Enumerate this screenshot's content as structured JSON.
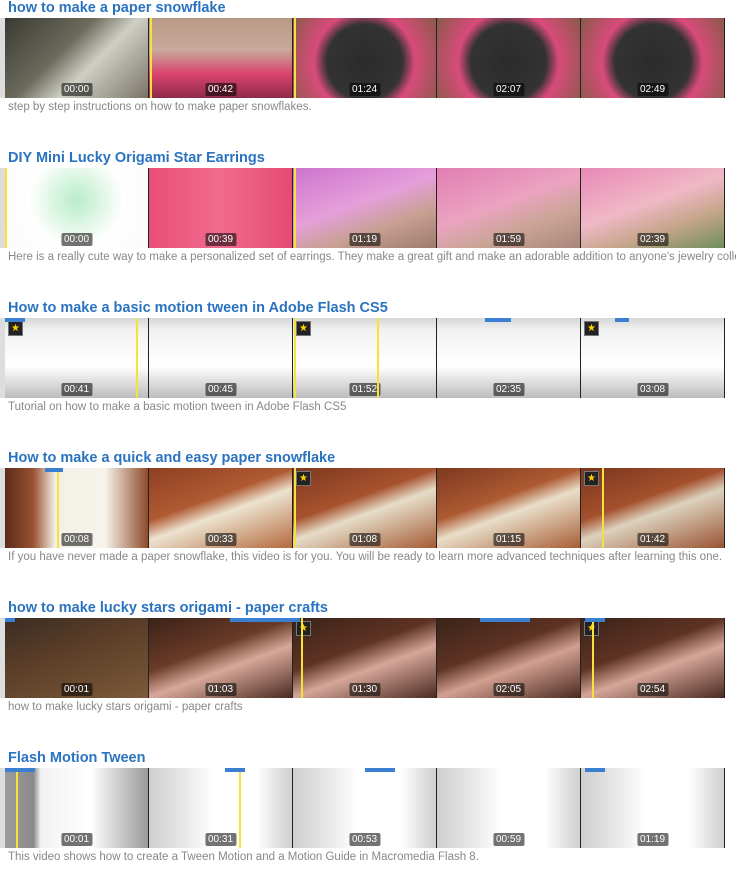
{
  "videos": [
    {
      "title": "how to make a paper snowflake",
      "description": "step by step instructions on how to make paper snowflakes.",
      "frames": [
        {
          "time": "00:00",
          "bg": "linear-gradient(135deg,#3a3a34 0%,#6b6a5c 40%,#cfcfc6 60%,#7a7468 100%)",
          "star": false
        },
        {
          "time": "00:42",
          "bg": "linear-gradient(180deg,#b79a86 0%,#c8a99a 40%,#d9446e 70%,#8e2a4a 100%)",
          "star": false
        },
        {
          "time": "01:24",
          "bg": "radial-gradient(circle at 50% 55%,#2b2b2b 0%,#333 45%,#d84b7a 60%,#8a5a4a 100%)",
          "star": false
        },
        {
          "time": "02:07",
          "bg": "radial-gradient(circle at 50% 55%,#2b2b2b 0%,#333 45%,#d84b7a 60%,#8a5a4a 100%)",
          "star": false
        },
        {
          "time": "02:49",
          "bg": "radial-gradient(circle at 50% 55%,#2b2b2b 0%,#333 45%,#d84b7a 60%,#8a5a4a 100%)",
          "star": false
        }
      ]
    },
    {
      "title": "DIY Mini Lucky Origami Star Earrings",
      "description": "Here is a really cute way to make a personalized set of earrings. They make a great gift and make an adorable addition to anyone's jewelry collection.",
      "frames": [
        {
          "time": "00:00",
          "bg": "radial-gradient(circle at 50% 40%,#b9ecc8 0%,#ffffff 55%,#fafafa 100%)",
          "star": false
        },
        {
          "time": "00:39",
          "bg": "linear-gradient(90deg,#ea4d79 0%,#f06b8e 50%,#e64a73 100%)",
          "star": false
        },
        {
          "time": "01:19",
          "bg": "linear-gradient(160deg,#cc74cf 0%,#e59fd9 45%,#c7a092 70%,#9d7b6c 100%)",
          "star": false
        },
        {
          "time": "01:59",
          "bg": "linear-gradient(160deg,#e27db2 0%,#eba3c0 45%,#caa596 70%,#a8857a 100%)",
          "star": false
        },
        {
          "time": "02:39",
          "bg": "linear-gradient(160deg,#e889b6 0%,#f0b8c6 45%,#c5a68a 70%,#6f8d5c 100%)",
          "star": false
        }
      ]
    },
    {
      "title": "How to make a basic motion tween in Adobe Flash CS5",
      "description": "Tutorial on how to make a basic motion tween in Adobe Flash CS5",
      "frames": [
        {
          "time": "00:41",
          "bg": "linear-gradient(180deg,#d6d6d6 0%,#f2f2f2 15%,#ffffff 60%,#bdbdbd 100%)",
          "star": true
        },
        {
          "time": "00:45",
          "bg": "linear-gradient(180deg,#d6d6d6 0%,#f2f2f2 15%,#ffffff 60%,#bdbdbd 100%)",
          "star": false
        },
        {
          "time": "01:52",
          "bg": "linear-gradient(180deg,#d6d6d6 0%,#f2f2f2 15%,#ffffff 60%,#bdbdbd 100%)",
          "star": true
        },
        {
          "time": "02:35",
          "bg": "linear-gradient(180deg,#d6d6d6 0%,#f2f2f2 15%,#ffffff 60%,#bdbdbd 100%)",
          "star": false
        },
        {
          "time": "03:08",
          "bg": "linear-gradient(180deg,#d6d6d6 0%,#f2f2f2 15%,#ffffff 60%,#bdbdbd 100%)",
          "star": true
        }
      ]
    },
    {
      "title": "How to make a quick and easy paper snowflake",
      "description": "If you have never made a paper snowflake, this video is for you. You will be ready to learn more advanced techniques after learning this one.",
      "frames": [
        {
          "time": "00:08",
          "bg": "linear-gradient(90deg,#5b2b1a 0%,#9a5332 20%,#f3f0e8 35%,#f6f3ea 70%,#8e4b2b 100%)",
          "star": false
        },
        {
          "time": "00:33",
          "bg": "linear-gradient(160deg,#8e3f22 0%,#b05a33 40%,#ece3d0 55%,#b4693c 100%)",
          "star": false
        },
        {
          "time": "01:08",
          "bg": "linear-gradient(160deg,#7e3820 0%,#a7522e 40%,#e6ddc9 55%,#a45a33 100%)",
          "star": true
        },
        {
          "time": "01:15",
          "bg": "linear-gradient(160deg,#7e3820 0%,#ad5a32 40%,#e9deca 55%,#a85e35 100%)",
          "star": false
        },
        {
          "time": "01:42",
          "bg": "linear-gradient(160deg,#7a3620 0%,#a4502c 40%,#dcd2be 55%,#9a5332 100%)",
          "star": true
        }
      ]
    },
    {
      "title": "how to make lucky stars origami - paper crafts",
      "description": "how to make lucky stars origami - paper crafts",
      "frames": [
        {
          "time": "00:01",
          "bg": "linear-gradient(160deg,#3a2d22 0%,#5a3d28 40%,#7a5a3a 100%)",
          "star": false
        },
        {
          "time": "01:03",
          "bg": "linear-gradient(160deg,#3a2318 0%,#6a3a28 40%,#d8a89a 60%,#4a2a20 100%)",
          "star": false
        },
        {
          "time": "01:30",
          "bg": "linear-gradient(160deg,#3a2318 0%,#5e3324 40%,#d6a699 60%,#4a2a20 100%)",
          "star": true
        },
        {
          "time": "02:05",
          "bg": "linear-gradient(160deg,#3a2318 0%,#5e3324 40%,#d29f90 60%,#4a2a20 100%)",
          "star": false
        },
        {
          "time": "02:54",
          "bg": "linear-gradient(160deg,#3a2318 0%,#5e3324 40%,#d6a699 60%,#4a2a20 100%)",
          "star": true
        }
      ]
    },
    {
      "title": "Flash Motion Tween",
      "description": "This video shows how to create a Tween Motion and a Motion Guide in Macromedia Flash 8.",
      "frames": [
        {
          "time": "00:01",
          "bg": "linear-gradient(90deg,#9c9c9c 0%,#8a8a8a 20%,#f2f2f2 25%,#ffffff 60%,#9a9a9a 100%)",
          "star": false
        },
        {
          "time": "00:31",
          "bg": "linear-gradient(90deg,#cfcfcf 0%,#e8e8e8 25%,#ffffff 45%,#ffffff 75%,#cfcfcf 100%)",
          "star": false
        },
        {
          "time": "00:53",
          "bg": "linear-gradient(90deg,#cfcfcf 0%,#e8e8e8 25%,#ffffff 45%,#ffffff 75%,#cfcfcf 100%)",
          "star": false
        },
        {
          "time": "00:59",
          "bg": "linear-gradient(90deg,#cfcfcf 0%,#e8e8e8 25%,#ffffff 45%,#ffffff 75%,#cfcfcf 100%)",
          "star": false
        },
        {
          "time": "01:19",
          "bg": "linear-gradient(90deg,#cfcfcf 0%,#e8e8e8 25%,#ffffff 45%,#ffffff 75%,#cfcfcf 100%)",
          "star": false
        }
      ]
    }
  ],
  "colors": {
    "title": "#2a73c0",
    "description": "#888888",
    "marker": "#f6e23a",
    "progress": "#3b7fd1"
  },
  "icons": {
    "star": "star-icon"
  }
}
